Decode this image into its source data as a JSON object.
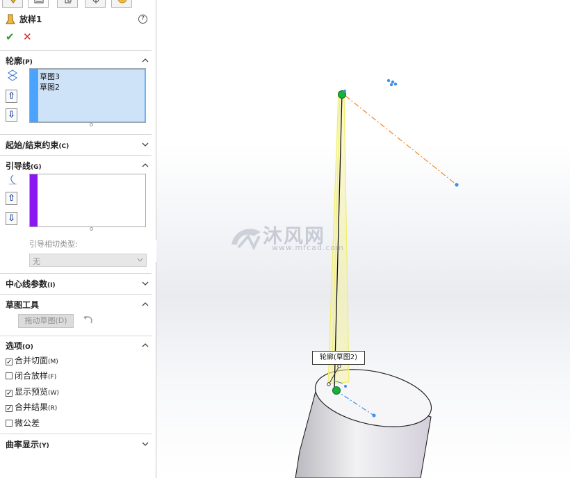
{
  "feature": {
    "title": "放样1",
    "help_icon": "?",
    "ok_icon": "✔",
    "cancel_icon": "✕"
  },
  "tabs": [
    {
      "icon": "feature-manager-tree-icon"
    },
    {
      "icon": "property-manager-icon"
    },
    {
      "icon": "configuration-manager-icon"
    },
    {
      "icon": "dimxpert-manager-icon"
    },
    {
      "icon": "display-manager-icon"
    }
  ],
  "sections": {
    "profiles": {
      "label": "轮廓",
      "shortcut": "(P)",
      "items": [
        "草图3",
        "草图2"
      ]
    },
    "start_end": {
      "label": "起始/结束约束",
      "shortcut": "(C)"
    },
    "guides": {
      "label": "引导线",
      "shortcut": "(G)",
      "tangency_label": "引导相切类型:",
      "tangency_value": "无"
    },
    "centerline": {
      "label": "中心线参数",
      "shortcut": "(I)"
    },
    "sketch_tools": {
      "label": "草图工具",
      "drag_button": "拖动草图(D)"
    },
    "options": {
      "label": "选项",
      "shortcut": "(O)",
      "items": [
        {
          "label": "合并切面",
          "shortcut": "(M)",
          "checked": true
        },
        {
          "label": "闭合放样",
          "shortcut": "(F)",
          "checked": false
        },
        {
          "label": "显示预览",
          "shortcut": "(W)",
          "checked": true
        },
        {
          "label": "合并结果",
          "shortcut": "(R)",
          "checked": true
        },
        {
          "label": "微公差",
          "shortcut": "",
          "checked": false
        }
      ]
    },
    "curvature": {
      "label": "曲率显示",
      "shortcut": "(Y)"
    }
  },
  "viewport": {
    "callout": "轮廓(草图2)",
    "watermark_cn": "沐风网",
    "watermark_en": "www.mfcad.com"
  },
  "colors": {
    "profile_bar": "#4aa3ff",
    "guide_bar": "#8b18f0",
    "list_selected": "#cfe3f8",
    "preview": "#f2ee6a",
    "accent_orange": "#f08a24",
    "point_green": "#19b03b",
    "point_blue": "#3f8fe6"
  }
}
